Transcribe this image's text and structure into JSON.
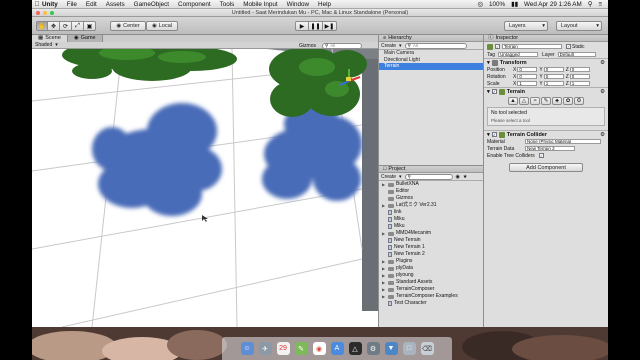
{
  "menubar": {
    "app": "Unity",
    "menus": [
      "File",
      "Edit",
      "Assets",
      "GameObject",
      "Component",
      "Tools",
      "Mobile Input",
      "Window",
      "Help"
    ],
    "battery": "100%",
    "clock": "Wed Apr 29  1:26 AM"
  },
  "window": {
    "title": "Untitled - Saat Merindukan Mu - PC, Mac & Linux Standalone (Personal)"
  },
  "toolbar": {
    "center_label": "Center",
    "local_label": "Local",
    "layers_label": "Layers",
    "layout_label": "Layout"
  },
  "scene": {
    "tab_scene": "Scene",
    "tab_game": "Game",
    "shading_mode": "Shaded",
    "gizmos_label": "Gizmos",
    "search_placeholder": "All"
  },
  "hierarchy": {
    "title": "Hierarchy",
    "create_label": "Create",
    "search_placeholder": "All",
    "items": [
      {
        "label": "Main Camera",
        "selected": false
      },
      {
        "label": "Directional Light",
        "selected": false
      },
      {
        "label": "Terrain",
        "selected": true
      }
    ]
  },
  "project": {
    "title": "Project",
    "create_label": "Create",
    "items": [
      {
        "label": "BulletXNA",
        "kind": "folder",
        "expandable": true
      },
      {
        "label": "Editor",
        "kind": "folder",
        "expandable": false
      },
      {
        "label": "Gizmos",
        "kind": "folder",
        "expandable": false
      },
      {
        "label": "Lat式ミク Ver2.31",
        "kind": "folder",
        "expandable": true
      },
      {
        "label": "link",
        "kind": "file",
        "expandable": false
      },
      {
        "label": "Miku",
        "kind": "file",
        "expandable": false
      },
      {
        "label": "Miku",
        "kind": "file",
        "expandable": false
      },
      {
        "label": "MMD4Mecanim",
        "kind": "folder",
        "expandable": true
      },
      {
        "label": "New Terrain",
        "kind": "file",
        "expandable": false
      },
      {
        "label": "New Terrain 1",
        "kind": "file",
        "expandable": false
      },
      {
        "label": "New Terrain 2",
        "kind": "file",
        "expandable": false
      },
      {
        "label": "Plugins",
        "kind": "folder",
        "expandable": true
      },
      {
        "label": "plyData",
        "kind": "folder",
        "expandable": true
      },
      {
        "label": "plyoung",
        "kind": "folder",
        "expandable": true
      },
      {
        "label": "Standard Assets",
        "kind": "folder",
        "expandable": true
      },
      {
        "label": "TerrainComposer",
        "kind": "folder",
        "expandable": true
      },
      {
        "label": "TerrainComposer Examples",
        "kind": "folder",
        "expandable": true
      },
      {
        "label": "Test Character",
        "kind": "file",
        "expandable": false
      }
    ]
  },
  "inspector": {
    "title": "Inspector",
    "object_name": "Terrain",
    "static_label": "Static",
    "tag_label": "Tag",
    "tag_value": "Untagged",
    "layer_label": "Layer",
    "layer_value": "Default",
    "transform": {
      "title": "Transform",
      "rows": [
        {
          "label": "Position",
          "x": "0",
          "y": "0",
          "z": "0"
        },
        {
          "label": "Rotation",
          "x": "0",
          "y": "0",
          "z": "0"
        },
        {
          "label": "Scale",
          "x": "1",
          "y": "1",
          "z": "1"
        }
      ]
    },
    "terrain": {
      "title": "Terrain",
      "no_tool": "No tool selected",
      "hint": "Please select a tool"
    },
    "collider": {
      "title": "Terrain Collider",
      "material_label": "Material",
      "material_value": "None (Physic Material",
      "data_label": "Terrain Data",
      "data_value": "New Terrain 2",
      "trees_label": "Enable Tree Colliders"
    },
    "add_component": "Add Component"
  },
  "colors": {
    "selection": "#3d80df",
    "shadow": "#4a6cb8",
    "tree": "#2e6b22"
  }
}
